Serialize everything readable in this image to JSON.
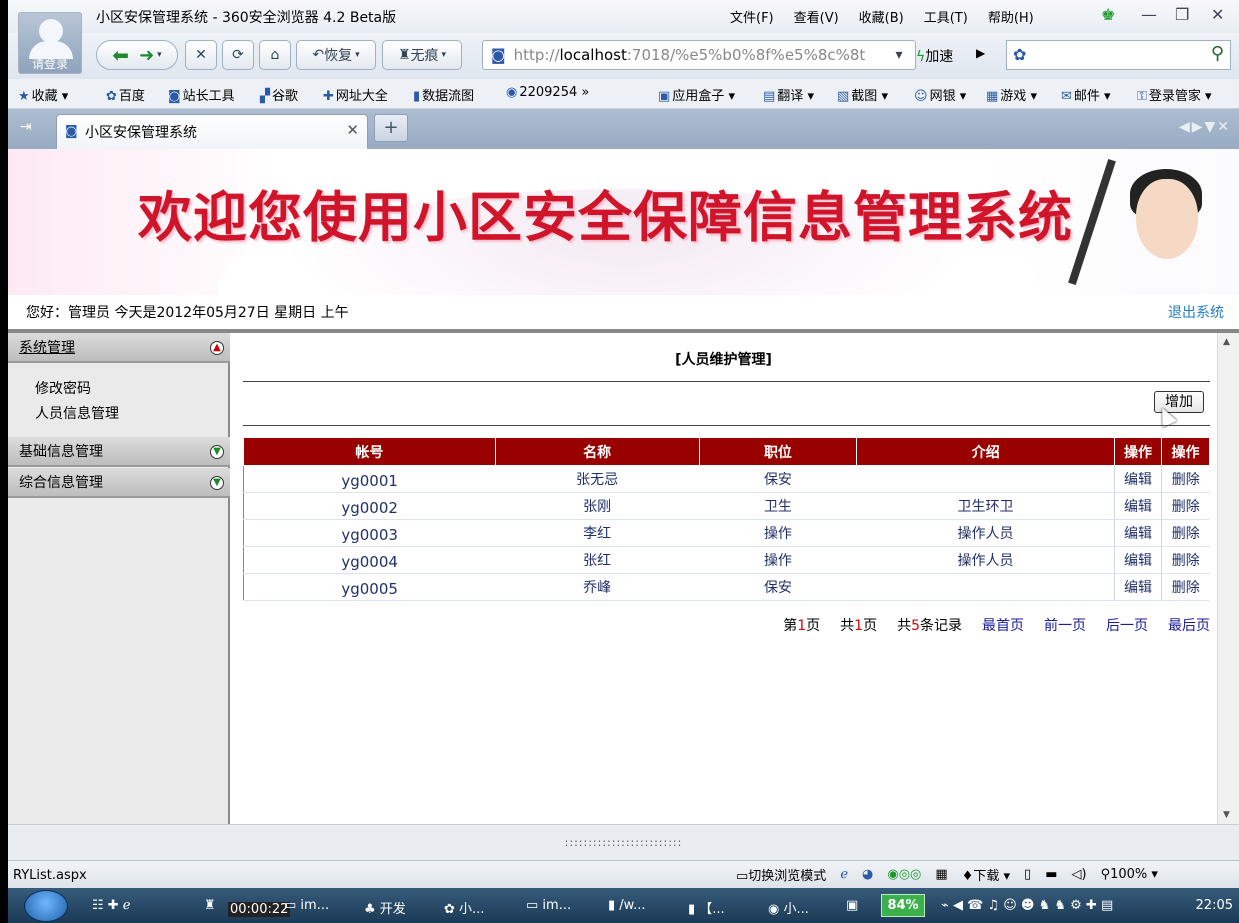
{
  "window": {
    "title": "小区安保管理系统 - 360安全浏览器 4.2 Beta版",
    "login_label": "请登录",
    "menu": [
      "文件(F)",
      "查看(V)",
      "收藏(B)",
      "工具(T)",
      "帮助(H)"
    ]
  },
  "nav": {
    "restore_label": "恢复",
    "incognito_label": "无痕",
    "url_prefix": "http://",
    "url_host": "localhost",
    "url_rest": ":7018/%e5%b0%8f%e5%8c%8t",
    "speed_label": "加速"
  },
  "favorites": [
    {
      "icon": "star-icon",
      "label": "收藏"
    },
    {
      "icon": "baidu-icon",
      "label": "百度"
    },
    {
      "icon": "page-icon",
      "label": "站长工具"
    },
    {
      "icon": "google-icon",
      "label": "谷歌"
    },
    {
      "icon": "web-icon",
      "label": "网址大全"
    },
    {
      "icon": "folder-icon",
      "label": "数据流图"
    },
    {
      "icon": "globe-icon",
      "label": "2209254"
    },
    {
      "icon": "box-icon",
      "label": "应用盒子"
    },
    {
      "icon": "translate-icon",
      "label": "翻译"
    },
    {
      "icon": "screenshot-icon",
      "label": "截图"
    },
    {
      "icon": "bank-icon",
      "label": "网银"
    },
    {
      "icon": "game-icon",
      "label": "游戏"
    },
    {
      "icon": "mail-icon",
      "label": "邮件"
    },
    {
      "icon": "key-icon",
      "label": "登录管家"
    }
  ],
  "tab": {
    "label": "小区安保管理系统"
  },
  "header": {
    "banner_title": "欢迎您使用小区安全保障信息管理系统",
    "welcome": "您好：管理员   今天是2012年05月27日   星期日   上午",
    "logout": "退出系统"
  },
  "sidebar": {
    "sections": [
      {
        "label": "系统管理",
        "items": [
          "修改密码",
          "人员信息管理"
        ]
      },
      {
        "label": "基础信息管理",
        "items": []
      },
      {
        "label": "综合信息管理",
        "items": []
      }
    ]
  },
  "main": {
    "title": "[人员维护管理]",
    "add_button": "增加",
    "columns": [
      "帐号",
      "名称",
      "职位",
      "介绍",
      "操作",
      "操作"
    ],
    "rows": [
      {
        "account": "yg0001",
        "name": "张无忌",
        "position": "保安",
        "intro": "",
        "edit": "编辑",
        "delete": "删除"
      },
      {
        "account": "yg0002",
        "name": "张刚",
        "position": "卫生",
        "intro": "卫生环卫",
        "edit": "编辑",
        "delete": "删除"
      },
      {
        "account": "yg0003",
        "name": "李红",
        "position": "操作",
        "intro": "操作人员",
        "edit": "编辑",
        "delete": "删除"
      },
      {
        "account": "yg0004",
        "name": "张红",
        "position": "操作",
        "intro": "操作人员",
        "edit": "编辑",
        "delete": "删除"
      },
      {
        "account": "yg0005",
        "name": "乔峰",
        "position": "保安",
        "intro": "",
        "edit": "编辑",
        "delete": "删除"
      }
    ],
    "pager": {
      "page_prefix": "第",
      "page": "1",
      "page_suffix": "页",
      "total_prefix": "共",
      "total_pages": "1",
      "total_suffix": "页",
      "rec_prefix": "共",
      "records": "5",
      "rec_suffix": "条记录",
      "first": "最首页",
      "prev": "前一页",
      "next": "后一页",
      "last": "最后页"
    }
  },
  "statusbar": {
    "url": "RYList.aspx",
    "mode": "切换浏览模式",
    "download": "下载",
    "zoom": "100%"
  },
  "taskbar": {
    "timer": "00:00:22",
    "items": [
      "im...",
      "开发",
      "小...",
      "im...",
      "/w...",
      "【...",
      "小..."
    ],
    "battery": "84%",
    "clock": "22:05"
  },
  "colors": {
    "accent": "#990000",
    "banner_text": "#d0142a",
    "link": "#1f7ec4"
  }
}
